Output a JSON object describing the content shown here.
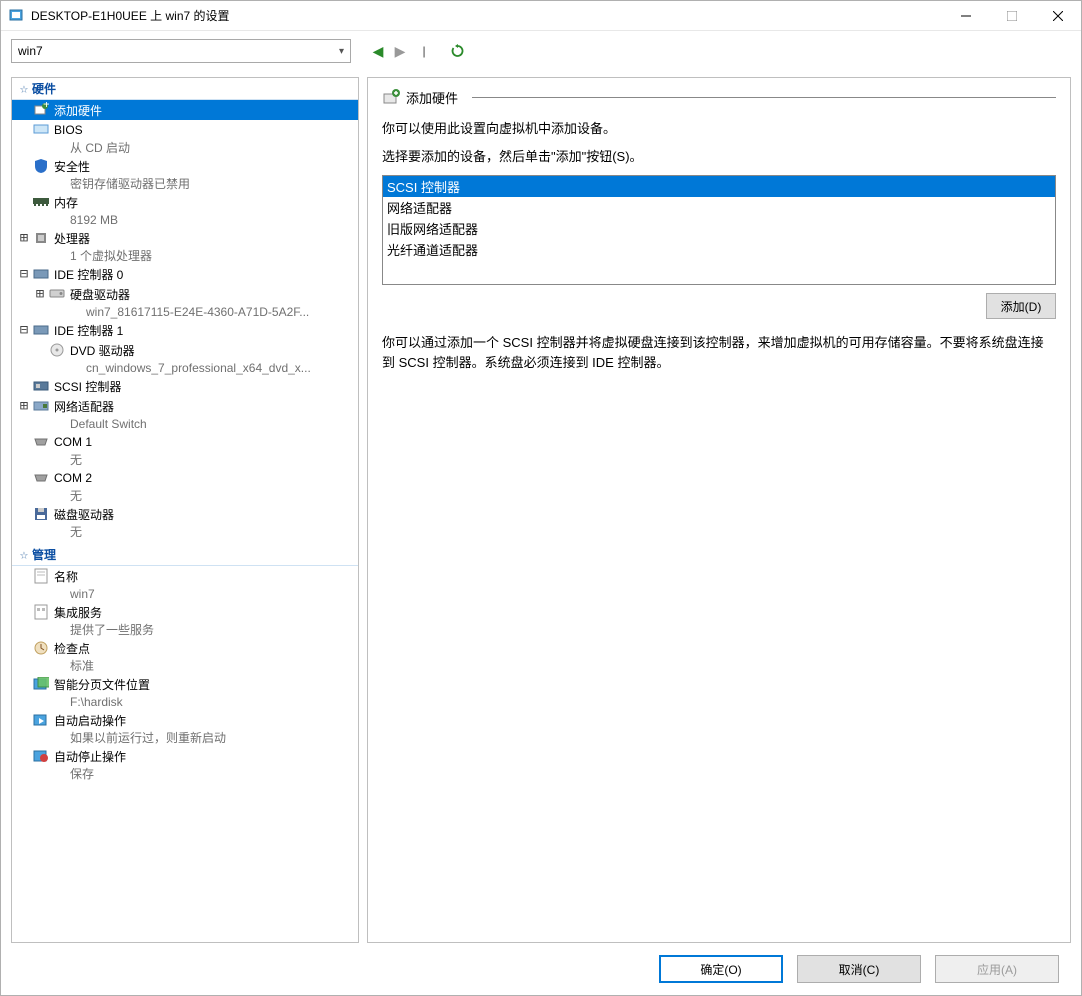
{
  "window": {
    "title": "DESKTOP-E1H0UEE 上 win7 的设置"
  },
  "toolbar": {
    "vm_name": "win7"
  },
  "tree": {
    "hardware_header": "硬件",
    "management_header": "管理",
    "items": [
      {
        "label": "添加硬件",
        "sub": ""
      },
      {
        "label": "BIOS",
        "sub": "从 CD 启动"
      },
      {
        "label": "安全性",
        "sub": "密钥存储驱动器已禁用"
      },
      {
        "label": "内存",
        "sub": "8192 MB"
      },
      {
        "label": "处理器",
        "sub": "1 个虚拟处理器"
      },
      {
        "label": "IDE 控制器 0",
        "sub": ""
      },
      {
        "label": "硬盘驱动器",
        "sub": "win7_81617115-E24E-4360-A71D-5A2F..."
      },
      {
        "label": "IDE 控制器 1",
        "sub": ""
      },
      {
        "label": "DVD 驱动器",
        "sub": "cn_windows_7_professional_x64_dvd_x..."
      },
      {
        "label": "SCSI 控制器",
        "sub": ""
      },
      {
        "label": "网络适配器",
        "sub": "Default Switch"
      },
      {
        "label": "COM 1",
        "sub": "无"
      },
      {
        "label": "COM 2",
        "sub": "无"
      },
      {
        "label": "磁盘驱动器",
        "sub": "无"
      }
    ],
    "mgmt": [
      {
        "label": "名称",
        "sub": "win7"
      },
      {
        "label": "集成服务",
        "sub": "提供了一些服务"
      },
      {
        "label": "检查点",
        "sub": "标准"
      },
      {
        "label": "智能分页文件位置",
        "sub": "F:\\hardisk"
      },
      {
        "label": "自动启动操作",
        "sub": "如果以前运行过，则重新启动"
      },
      {
        "label": "自动停止操作",
        "sub": "保存"
      }
    ]
  },
  "right": {
    "title": "添加硬件",
    "intro": "你可以使用此设置向虚拟机中添加设备。",
    "instruction": "选择要添加的设备，然后单击\"添加\"按钮(S)。",
    "options": [
      "SCSI 控制器",
      "网络适配器",
      "旧版网络适配器",
      "光纤通道适配器"
    ],
    "add_btn": "添加(D)",
    "description": "你可以通过添加一个 SCSI 控制器并将虚拟硬盘连接到该控制器，来增加虚拟机的可用存储容量。不要将系统盘连接到 SCSI 控制器。系统盘必须连接到 IDE 控制器。"
  },
  "footer": {
    "ok": "确定(O)",
    "cancel": "取消(C)",
    "apply": "应用(A)"
  }
}
